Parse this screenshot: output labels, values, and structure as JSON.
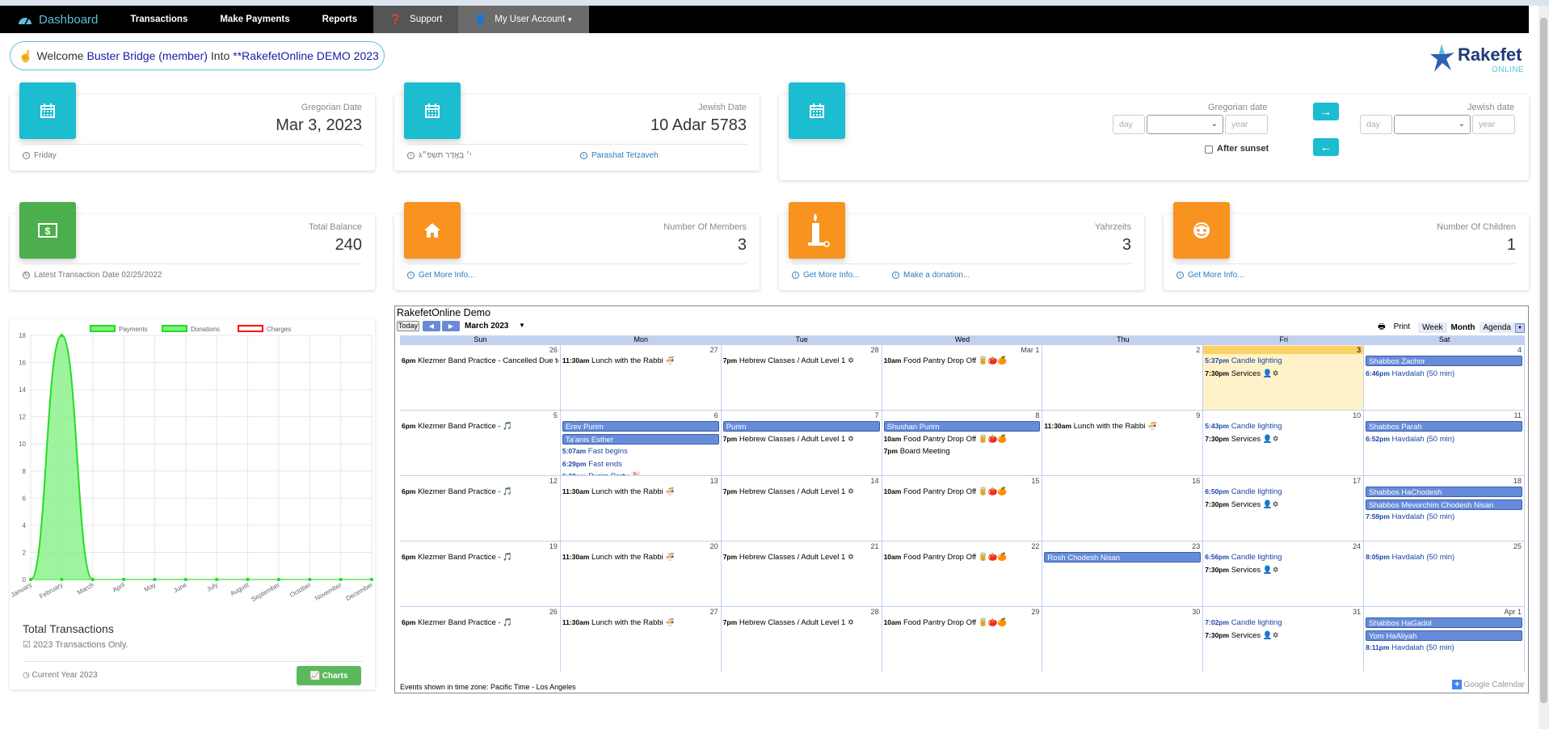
{
  "nav": {
    "brand": "Dashboard",
    "items": [
      "Transactions",
      "Make Payments",
      "Reports"
    ],
    "support": "Support",
    "account": "My User Account"
  },
  "welcome": {
    "prefix": "Welcome",
    "user": "Buster Bridge (member)",
    "mid": "Into",
    "org": "**RakefetOnline DEMO 2023"
  },
  "logo": {
    "name": "Rakefet",
    "sub": "ONLINE"
  },
  "cards": {
    "gregorian": {
      "label": "Gregorian Date",
      "value": "Mar 3, 2023",
      "foot": "Friday"
    },
    "jewish": {
      "label": "Jewish Date",
      "value": "10 Adar 5783",
      "foot": "י׳ בְּאֲדָר תשפ״ג",
      "foot2": "Parashat Tetzaveh"
    },
    "converter": {
      "greg_label": "Gregorian date",
      "jew_label": "Jewish date",
      "day_ph": "day",
      "year_ph": "year",
      "after_sunset": "After sunset"
    },
    "balance": {
      "label": "Total Balance",
      "value": "240",
      "foot": "Latest Transaction Date 02/25/2022"
    },
    "members": {
      "label": "Number Of Members",
      "value": "3",
      "foot": "Get More Info..."
    },
    "yahrzeits": {
      "label": "Yahrzeits",
      "value": "3",
      "foot": "Get More Info...",
      "foot2": "Make a donation..."
    },
    "children": {
      "label": "Number Of Children",
      "value": "1",
      "foot": "Get More Info..."
    }
  },
  "chart_data": {
    "type": "area",
    "categories": [
      "January",
      "February",
      "March",
      "April",
      "May",
      "June",
      "July",
      "August",
      "September",
      "October",
      "November",
      "December"
    ],
    "series": [
      {
        "name": "Payments",
        "values": [
          0,
          0,
          0,
          0,
          0,
          0,
          0,
          0,
          0,
          0,
          0,
          0
        ]
      },
      {
        "name": "Donations",
        "values": [
          0,
          18,
          0,
          0,
          0,
          0,
          0,
          0,
          0,
          0,
          0,
          0
        ]
      },
      {
        "name": "Charges",
        "values": [
          0,
          0,
          0,
          0,
          0,
          0,
          0,
          0,
          0,
          0,
          0,
          0
        ]
      }
    ],
    "yticks": [
      0,
      2,
      4,
      6,
      8,
      10,
      12,
      14,
      16,
      18
    ],
    "ylim": [
      0,
      18
    ],
    "legend": "top",
    "colors": {
      "Payments": "#7df07d",
      "Donations": "#7df07d",
      "Charges": "#ff0000"
    },
    "grid": true
  },
  "chart_panel": {
    "title": "Total Transactions",
    "subtitle": "2023 Transactions Only.",
    "footer": "Current Year 2023",
    "button": "Charts"
  },
  "calendar": {
    "title": "RakefetOnline Demo",
    "today": "Today",
    "month": "March 2023",
    "print": "Print",
    "views": [
      "Week",
      "Month",
      "Agenda"
    ],
    "days": [
      "Sun",
      "Mon",
      "Tue",
      "Wed",
      "Thu",
      "Fri",
      "Sat"
    ],
    "weeks": [
      [
        {
          "d": "26",
          "ev": [
            {
              "t": "6pm",
              "x": "Klezmer Band Practice - Cancelled Due to Weather"
            }
          ]
        },
        {
          "d": "27",
          "ev": [
            {
              "t": "11:30am",
              "x": "Lunch with the Rabbi 🍜"
            }
          ]
        },
        {
          "d": "28",
          "ev": [
            {
              "t": "7pm",
              "x": "Hebrew Classes / Adult Level 1 ✡"
            }
          ]
        },
        {
          "d": "Mar 1",
          "ev": [
            {
              "t": "10am",
              "x": "Food Pantry Drop Off 🥫🍅🍊"
            }
          ]
        },
        {
          "d": "2",
          "ev": []
        },
        {
          "d": "3",
          "today": true,
          "ev": [
            {
              "t": "5:37pm",
              "x": "Candle lighting",
              "c": "blue"
            },
            {
              "t": "7:30pm",
              "x": "Services 👤✡"
            }
          ]
        },
        {
          "d": "4",
          "ev": [
            {
              "x": "Shabbos Zachor",
              "c": "blk"
            },
            {
              "t": "6:46pm",
              "x": "Havdalah (50 min)",
              "c": "blue"
            }
          ]
        }
      ],
      [
        {
          "d": "5",
          "ev": [
            {
              "t": "6pm",
              "x": "Klezmer Band Practice - 🎵"
            }
          ]
        },
        {
          "d": "6",
          "ev": [
            {
              "x": "Erev Purim",
              "c": "blk"
            },
            {
              "x": "Ta'anis Esther",
              "c": "blk"
            },
            {
              "t": "5:07am",
              "x": "Fast begins",
              "c": "blue"
            },
            {
              "t": "6:29pm",
              "x": "Fast ends",
              "c": "blue"
            },
            {
              "t": "6:30pm",
              "x": "Purim Party 🎉",
              "c": "blue"
            }
          ]
        },
        {
          "d": "7",
          "ev": [
            {
              "x": "Purim",
              "c": "blk"
            },
            {
              "t": "7pm",
              "x": "Hebrew Classes / Adult Level 1 ✡"
            }
          ]
        },
        {
          "d": "8",
          "ev": [
            {
              "x": "Shushan Purim",
              "c": "blk"
            },
            {
              "t": "10am",
              "x": "Food Pantry Drop Off 🥫🍅🍊"
            },
            {
              "t": "7pm",
              "x": "Board Meeting"
            }
          ]
        },
        {
          "d": "9",
          "ev": [
            {
              "t": "11:30am",
              "x": "Lunch with the Rabbi 🍜"
            }
          ]
        },
        {
          "d": "10",
          "ev": [
            {
              "t": "5:43pm",
              "x": "Candle lighting",
              "c": "blue"
            },
            {
              "t": "7:30pm",
              "x": "Services 👤✡"
            }
          ]
        },
        {
          "d": "11",
          "ev": [
            {
              "x": "Shabbos Parah",
              "c": "blk"
            },
            {
              "t": "6:52pm",
              "x": "Havdalah (50 min)",
              "c": "blue"
            }
          ]
        }
      ],
      [
        {
          "d": "12",
          "ev": [
            {
              "t": "6pm",
              "x": "Klezmer Band Practice - 🎵"
            }
          ]
        },
        {
          "d": "13",
          "ev": [
            {
              "t": "11:30am",
              "x": "Lunch with the Rabbi 🍜"
            }
          ]
        },
        {
          "d": "14",
          "ev": [
            {
              "t": "7pm",
              "x": "Hebrew Classes / Adult Level 1 ✡"
            }
          ]
        },
        {
          "d": "15",
          "ev": [
            {
              "t": "10am",
              "x": "Food Pantry Drop Off 🥫🍅🍊"
            }
          ]
        },
        {
          "d": "16",
          "ev": []
        },
        {
          "d": "17",
          "ev": [
            {
              "t": "6:50pm",
              "x": "Candle lighting",
              "c": "blue"
            },
            {
              "t": "7:30pm",
              "x": "Services 👤✡"
            }
          ]
        },
        {
          "d": "18",
          "ev": [
            {
              "x": "Shabbos HaChodesh",
              "c": "blk"
            },
            {
              "x": "Shabbos Mevorchim Chodesh Nisan",
              "c": "blk"
            },
            {
              "t": "7:59pm",
              "x": "Havdalah (50 min)",
              "c": "blue"
            }
          ]
        }
      ],
      [
        {
          "d": "19",
          "ev": [
            {
              "t": "6pm",
              "x": "Klezmer Band Practice - 🎵"
            }
          ]
        },
        {
          "d": "20",
          "ev": [
            {
              "t": "11:30am",
              "x": "Lunch with the Rabbi 🍜"
            }
          ]
        },
        {
          "d": "21",
          "ev": [
            {
              "t": "7pm",
              "x": "Hebrew Classes / Adult Level 1 ✡"
            }
          ]
        },
        {
          "d": "22",
          "ev": [
            {
              "t": "10am",
              "x": "Food Pantry Drop Off 🥫🍅🍊"
            }
          ]
        },
        {
          "d": "23",
          "ev": [
            {
              "x": "Rosh Chodesh Nisan",
              "c": "blk"
            }
          ]
        },
        {
          "d": "24",
          "ev": [
            {
              "t": "6:56pm",
              "x": "Candle lighting",
              "c": "blue"
            },
            {
              "t": "7:30pm",
              "x": "Services 👤✡"
            }
          ]
        },
        {
          "d": "25",
          "ev": [
            {
              "t": "8:05pm",
              "x": "Havdalah (50 min)",
              "c": "blue"
            }
          ]
        }
      ],
      [
        {
          "d": "26",
          "ev": [
            {
              "t": "6pm",
              "x": "Klezmer Band Practice - 🎵"
            }
          ]
        },
        {
          "d": "27",
          "ev": [
            {
              "t": "11:30am",
              "x": "Lunch with the Rabbi 🍜"
            }
          ]
        },
        {
          "d": "28",
          "ev": [
            {
              "t": "7pm",
              "x": "Hebrew Classes / Adult Level 1 ✡"
            }
          ]
        },
        {
          "d": "29",
          "ev": [
            {
              "t": "10am",
              "x": "Food Pantry Drop Off 🥫🍅🍊"
            }
          ]
        },
        {
          "d": "30",
          "ev": []
        },
        {
          "d": "31",
          "ev": [
            {
              "t": "7:02pm",
              "x": "Candle lighting",
              "c": "blue"
            },
            {
              "t": "7:30pm",
              "x": "Services 👤✡"
            }
          ]
        },
        {
          "d": "Apr 1",
          "ev": [
            {
              "x": "Shabbos HaGadol",
              "c": "blk"
            },
            {
              "x": "Yom HaAliyah",
              "c": "blk"
            },
            {
              "t": "8:11pm",
              "x": "Havdalah (50 min)",
              "c": "blue"
            }
          ]
        }
      ]
    ],
    "timezone": "Events shown in time zone: Pacific Time - Los Angeles",
    "gcal": "Google Calendar"
  }
}
